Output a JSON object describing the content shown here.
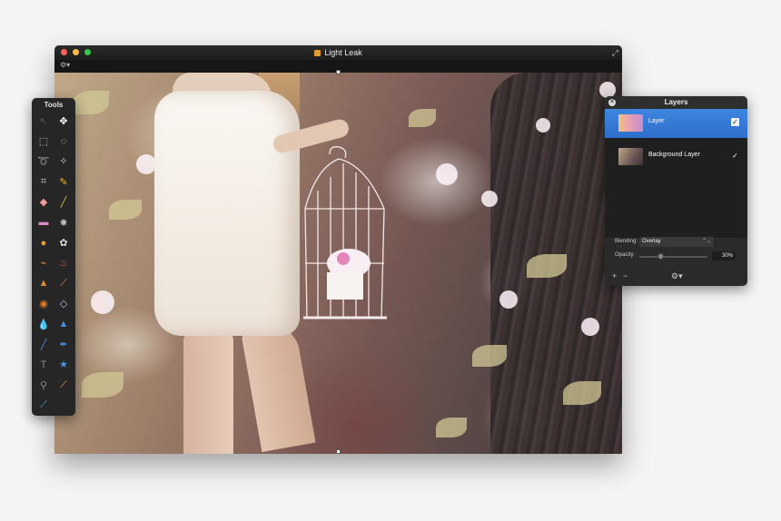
{
  "window": {
    "title": "Light Leak",
    "toolbar_gear": "⚙▾",
    "fullscreen_glyph": "⤢"
  },
  "tools": {
    "title": "Tools",
    "items": [
      {
        "name": "arrow-tool",
        "glyph": "↖",
        "color": "#555555"
      },
      {
        "name": "move-tool",
        "glyph": "✥",
        "color": "#ffffff"
      },
      {
        "name": "rect-select-tool",
        "glyph": "⬚",
        "color": "#cccccc"
      },
      {
        "name": "ellipse-select-tool",
        "glyph": "◌",
        "color": "#cccccc"
      },
      {
        "name": "lasso-tool",
        "glyph": "➰",
        "color": "#cccccc"
      },
      {
        "name": "magic-wand-tool",
        "glyph": "✧",
        "color": "#cccccc"
      },
      {
        "name": "crop-tool",
        "glyph": "⌗",
        "color": "#cccccc"
      },
      {
        "name": "color-picker-tool",
        "glyph": "✎",
        "color": "#f0b52a"
      },
      {
        "name": "eraser-tool",
        "glyph": "◆",
        "color": "#f29a9a"
      },
      {
        "name": "pencil-tool",
        "glyph": "╱",
        "color": "#d7b94a"
      },
      {
        "name": "gradient-tool",
        "glyph": "▬",
        "color": "#d78cc2"
      },
      {
        "name": "stamp-tool",
        "glyph": "✸",
        "color": "#bbbbbb"
      },
      {
        "name": "paint-bucket-tool",
        "glyph": "●",
        "color": "#e7a23a"
      },
      {
        "name": "brush-tool",
        "glyph": "✿",
        "color": "#dddddd"
      },
      {
        "name": "smudge-tool",
        "glyph": "⌁",
        "color": "#e07b2b"
      },
      {
        "name": "burn-tool",
        "glyph": "♨",
        "color": "#e0572b"
      },
      {
        "name": "clone-tool",
        "glyph": "▲",
        "color": "#d98a3a"
      },
      {
        "name": "heal-tool",
        "glyph": "⟋",
        "color": "#e08e5a"
      },
      {
        "name": "red-eye-tool",
        "glyph": "◉",
        "color": "#e07b2b"
      },
      {
        "name": "sharpen-tool",
        "glyph": "◇",
        "color": "#c7b0e0"
      },
      {
        "name": "blur-tool",
        "glyph": "💧",
        "color": "#4a90e2"
      },
      {
        "name": "dodge-tool",
        "glyph": "▲",
        "color": "#4a90e2"
      },
      {
        "name": "pen-tool",
        "glyph": "╱",
        "color": "#4a90e2"
      },
      {
        "name": "vector-brush-tool",
        "glyph": "✒",
        "color": "#4a90e2"
      },
      {
        "name": "type-tool",
        "glyph": "T",
        "color": "#888888"
      },
      {
        "name": "shape-tool",
        "glyph": "★",
        "color": "#4a90e2"
      },
      {
        "name": "zoom-tool",
        "glyph": "⚲",
        "color": "#888888"
      },
      {
        "name": "eyedropper-tool",
        "glyph": "⟋",
        "color": "#e7a23a"
      },
      {
        "name": "color-swatch",
        "glyph": "⟋",
        "color": "#4ab0e2"
      }
    ]
  },
  "layers": {
    "title": "Layers",
    "close_glyph": "✕",
    "items": [
      {
        "name": "Layer",
        "visible_check": "✓",
        "selected": true
      },
      {
        "name": "Background Layer",
        "visible_check": "✓",
        "selected": false
      }
    ],
    "blending_label": "Blending:",
    "blending_value": "Overlay",
    "blend_arrows": "⌃⌄",
    "opacity_label": "Opacity:",
    "opacity_value": "30%",
    "opacity_fraction": 0.3,
    "add_glyph": "+",
    "remove_glyph": "−",
    "gear_glyph": "⚙▾"
  }
}
